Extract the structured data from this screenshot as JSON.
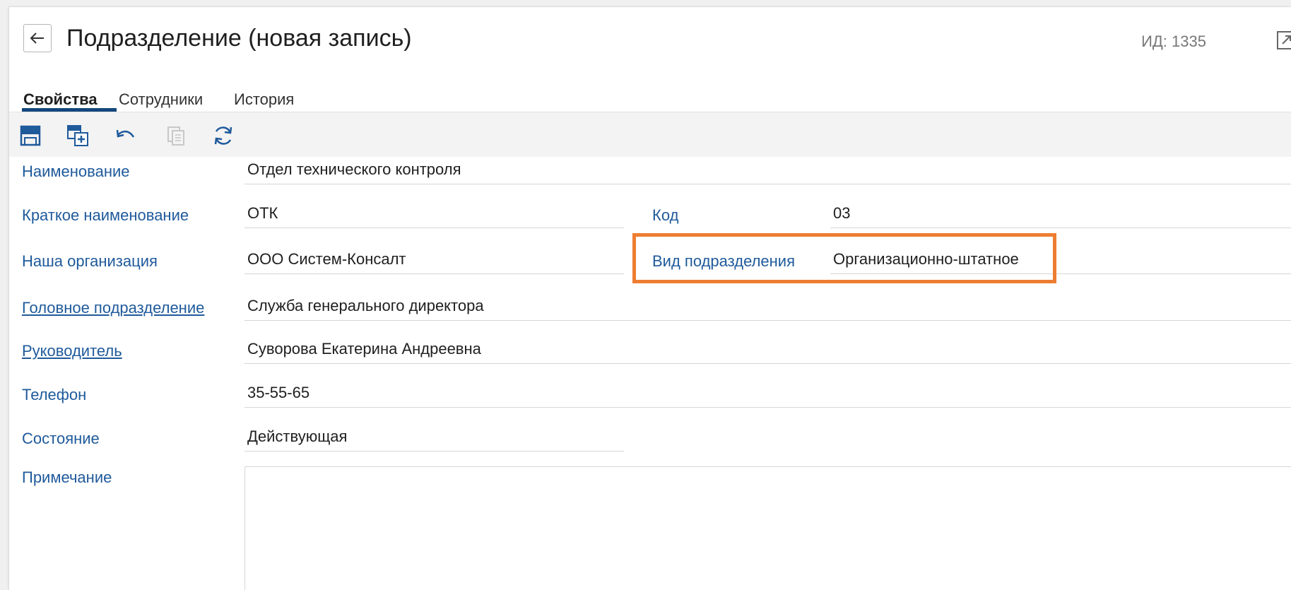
{
  "header": {
    "title": "Подразделение (новая запись)",
    "id_label": "ИД:",
    "id_value": "1335"
  },
  "tabs": [
    {
      "label": "Свойства",
      "active": true
    },
    {
      "label": "Сотрудники",
      "active": false
    },
    {
      "label": "История",
      "active": false
    }
  ],
  "toolbar": {
    "icons": [
      "save-icon",
      "save-and-create-icon",
      "undo-icon",
      "copy-icon",
      "refresh-icon"
    ],
    "copy_disabled": true
  },
  "form": {
    "name": {
      "label": "Наименование",
      "value": "Отдел технического контроля"
    },
    "short_name": {
      "label": "Краткое наименование",
      "value": "ОТК"
    },
    "code": {
      "label": "Код",
      "value": "03"
    },
    "organization": {
      "label": "Наша организация",
      "value": "ООО Систем-Консалт"
    },
    "department_type": {
      "label": "Вид подразделения",
      "value": "Организационно-штатное"
    },
    "parent_department": {
      "label": "Головное подразделение",
      "value": "Служба генерального директора"
    },
    "manager": {
      "label": "Руководитель",
      "value": "Суворова Екатерина Андреевна"
    },
    "phone": {
      "label": "Телефон",
      "value": "35-55-65"
    },
    "status": {
      "label": "Состояние",
      "value": "Действующая"
    },
    "note": {
      "label": "Примечание",
      "value": ""
    }
  },
  "colors": {
    "label": "#1f5a9b",
    "tab_underline": "#14467a",
    "highlight": "#ed7d31",
    "toolbar_icon": "#1f5a9b"
  }
}
